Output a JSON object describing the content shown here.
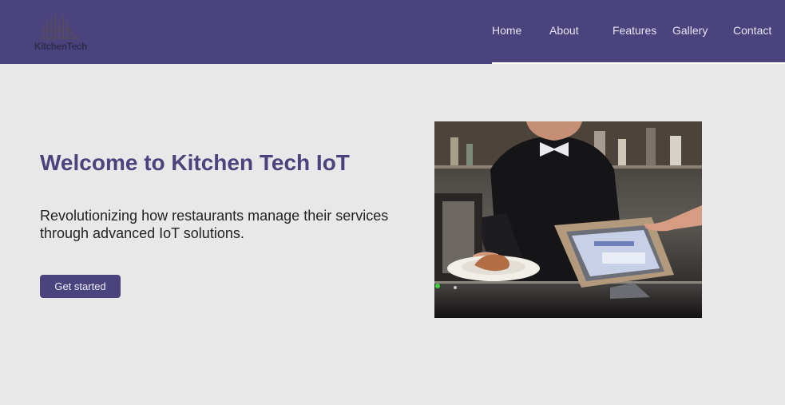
{
  "brand": {
    "name": "KitchenTech",
    "logo_icon": "kitchen-skyline-icon"
  },
  "nav": {
    "links": [
      {
        "label": "Home"
      },
      {
        "label": "About"
      },
      {
        "label": "Features"
      },
      {
        "label": "Gallery"
      },
      {
        "label": "Contact"
      }
    ],
    "active": "Home"
  },
  "hero": {
    "title": "Welcome to Kitchen Tech IoT",
    "description": "Revolutionizing how restaurants manage their services through advanced IoT solutions.",
    "cta_label": "Get started",
    "image_subject": "waiter-holding-plate-beside-pos-tablet"
  },
  "colors": {
    "primary": "#4b437e",
    "background": "#e8e8e8",
    "nav_text": "#e6e3f2",
    "title": "#4b437e"
  }
}
